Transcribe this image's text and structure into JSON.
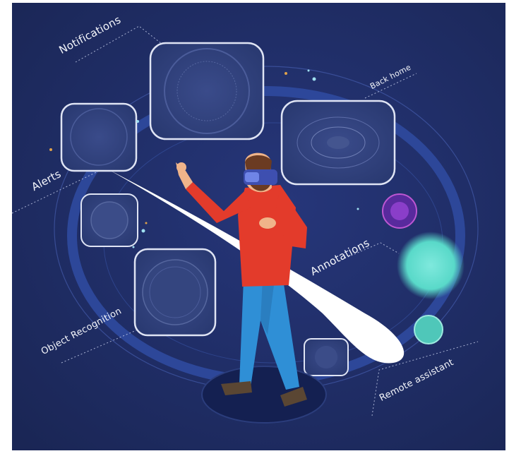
{
  "labels": {
    "notifications": "Notifications",
    "back_home": "Back home",
    "alerts": "Alerts",
    "annotations": "Annotations",
    "object_recognition": "Object Recognition",
    "remote_assistant": "Remote assistant"
  },
  "colors": {
    "background": "#1e2c5c",
    "panel_border": "#dfe4f4",
    "panel_fill": "#2d3d75",
    "orbit_ring": "#2f4a9e",
    "accent_teal": "#59d9c9",
    "accent_purple": "#7a2fb8",
    "shirt_red": "#e33b2b",
    "jeans_blue": "#2f8fd6",
    "beam": "#ffffff"
  }
}
